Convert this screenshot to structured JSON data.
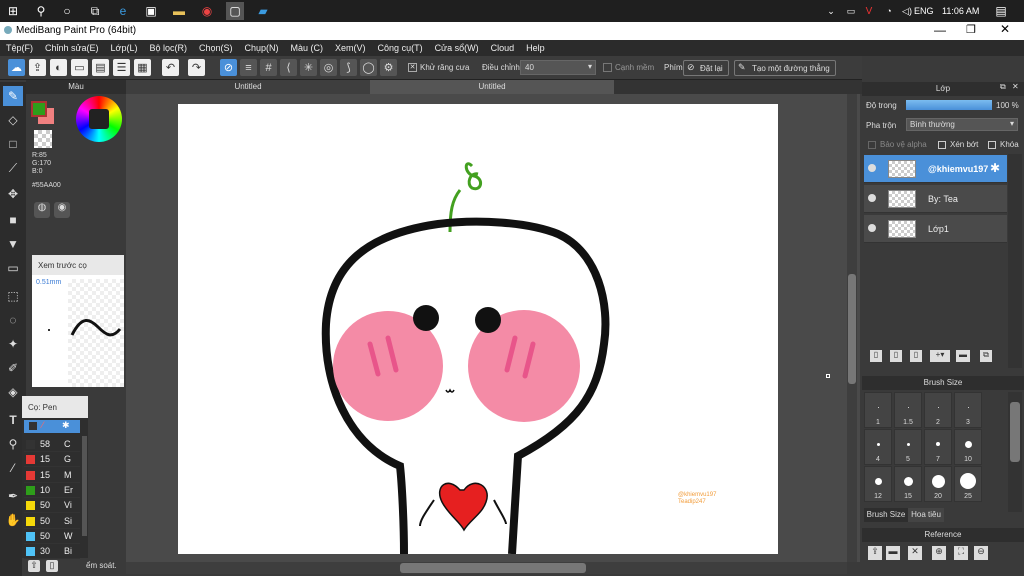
{
  "taskbar": {
    "lang": "ENG",
    "time": "11:06 AM"
  },
  "window": {
    "title": "MediBang Paint Pro (64bit)"
  },
  "menu": [
    "Tệp(F)",
    "Chỉnh sửa(E)",
    "Lớp(L)",
    "Bộ lọc(R)",
    "Chọn(S)",
    "Chụp(N)",
    "Màu (C)",
    "Xem(V)",
    "Công cụ(T)",
    "Cửa sổ(W)",
    "Cloud",
    "Help"
  ],
  "toolbar": {
    "antialias": "Khử răng cưa",
    "adjust": "Điều chỉnh",
    "adjust_value": "40",
    "edge": "Cạnh mềm",
    "key": "Phím",
    "reset": "Đặt lại",
    "new_line": "Tạo một đường thẳng"
  },
  "tabs": [
    "Untitled",
    "Untitled"
  ],
  "color_panel": {
    "title": "Màu",
    "r": "R:85",
    "g": "G:170",
    "b": "B:0",
    "hex": "#55AA00",
    "fg": "#2e9e1a",
    "bg": "#f08080"
  },
  "preview": {
    "title": "Xem trước cọ",
    "size": "0.51mm"
  },
  "brush_panel": {
    "title": "Cọ: Pen",
    "items": [
      {
        "size": "58",
        "label": "C",
        "color": "#333"
      },
      {
        "size": "15",
        "label": "G",
        "color": "#e53935"
      },
      {
        "size": "15",
        "label": "M",
        "color": "#e53935"
      },
      {
        "size": "10",
        "label": "Er",
        "color": "#2e9e1a"
      },
      {
        "size": "50",
        "label": "Vi",
        "color": "#f5d90a"
      },
      {
        "size": "50",
        "label": "Si",
        "color": "#f5d90a"
      },
      {
        "size": "50",
        "label": "W",
        "color": "#4fc3f7"
      },
      {
        "size": "30",
        "label": "Bi",
        "color": "#4fc3f7"
      }
    ],
    "footer": "ểm soát."
  },
  "layers_panel": {
    "title": "Lớp",
    "opacity_label": "Độ trong",
    "opacity_value": "100 %",
    "blend_label": "Pha trộn",
    "blend_value": "Bình thường",
    "protect_alpha": "Bảo vệ alpha",
    "clipping": "Xén bớt",
    "lock": "Khóa",
    "layers": [
      "@khiemvu197",
      "By: Tea",
      "Lớp1"
    ]
  },
  "brush_size_panel": {
    "title": "Brush Size",
    "sizes": [
      "1",
      "1.5",
      "2",
      "3",
      "4",
      "5",
      "7",
      "10",
      "12",
      "15",
      "20",
      "25"
    ],
    "tab1": "Brush Size",
    "tab2": "Hoa tiêu"
  },
  "reference_panel": {
    "title": "Reference"
  },
  "canvas": {
    "signature_line1": "@khiemvu197",
    "signature_line2": "Teadip247"
  }
}
